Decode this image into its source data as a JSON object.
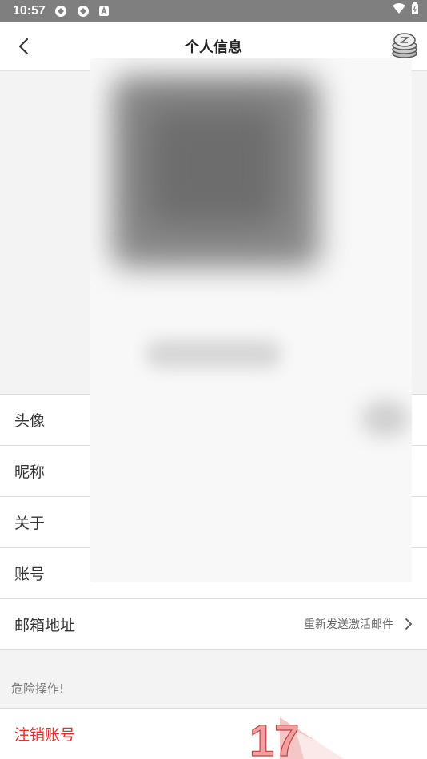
{
  "status_bar": {
    "time": "10:57"
  },
  "app_bar": {
    "title": "个人信息"
  },
  "profile_rows": [
    {
      "label": "头像"
    },
    {
      "label": "昵称"
    },
    {
      "label": "关于"
    },
    {
      "label": "账号"
    },
    {
      "label": "邮箱地址",
      "value": "重新发送激活邮件"
    }
  ],
  "danger": {
    "header": "危险操作!",
    "delete_account": "注销账号"
  },
  "watermark": {
    "text": "17"
  },
  "colors": {
    "danger": "#e03030",
    "status_bar": "#7f7f7f"
  },
  "icons": {
    "back": "back-arrow-icon",
    "coins": "coins-icon",
    "chevron": "chevron-right-icon"
  }
}
